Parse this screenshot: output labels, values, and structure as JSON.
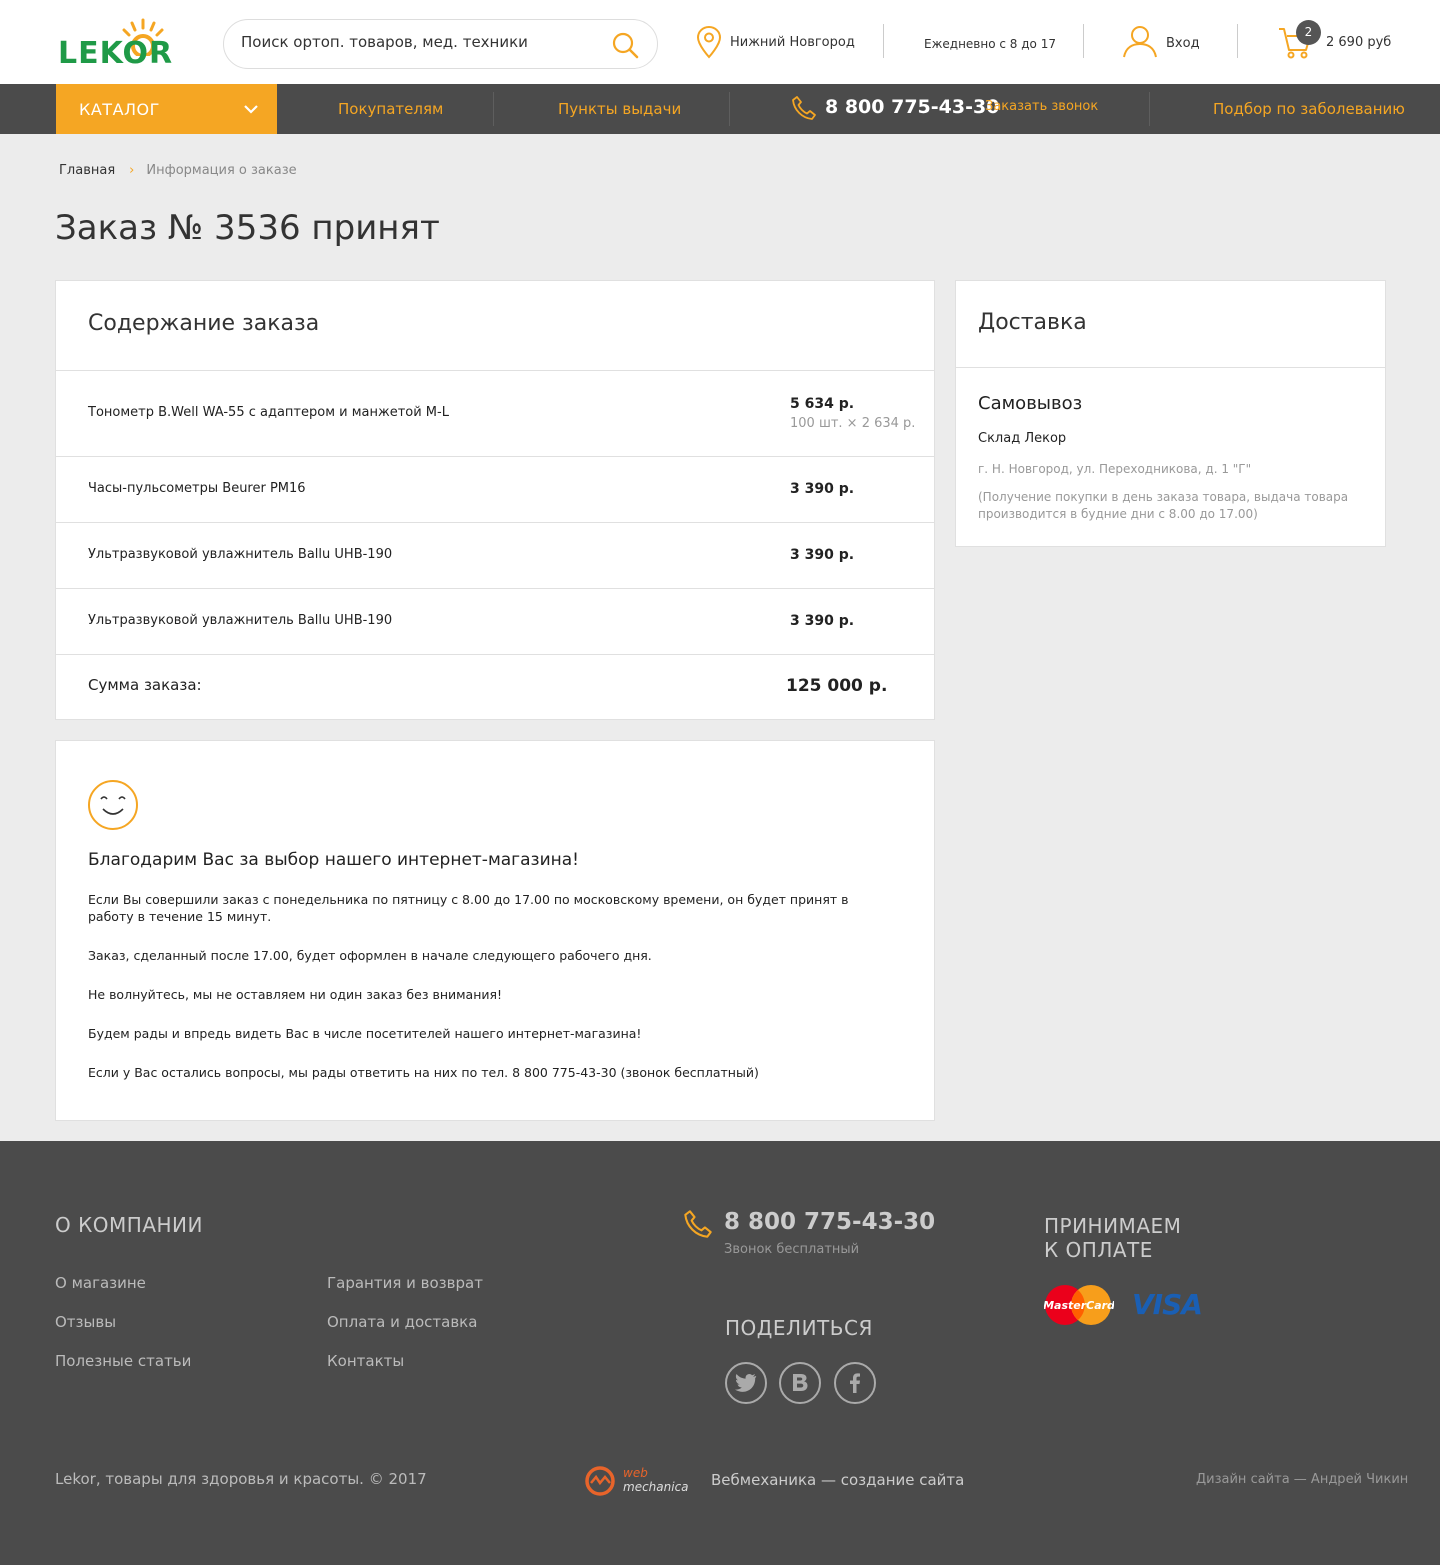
{
  "header": {
    "logo_text": "LEKOR",
    "search_placeholder": "Поиск ортоп. товаров, мед. техники",
    "city": "Нижний Новгород",
    "hours": "Ежедневно с 8 до 17",
    "login": "Вход",
    "cart_count": "2",
    "cart_sum": "2 690 руб"
  },
  "nav": {
    "catalog": "КАТАЛОГ",
    "buyers": "Покупателям",
    "pickup": "Пункты выдачи",
    "phone": "8 800 775-43-30",
    "callback": "Заказать звонок",
    "disease": "Подбор по заболеванию"
  },
  "breadcrumb": {
    "home": "Главная",
    "separator": "›",
    "current": "Информация о заказе"
  },
  "page_title": "Заказ № 3536 принят",
  "order": {
    "title": "Содержание заказа",
    "items": [
      {
        "name": "Тонометр B.Well WA-55 с адаптером и манжетой M-L",
        "price": "5 634 р.",
        "qty": "100 шт. × 2 634 р."
      },
      {
        "name": "Часы-пульсометры Beurer PM16",
        "price": "3 390 р."
      },
      {
        "name": "Ультразвуковой увлажнитель Ballu UHB-190",
        "price": "3 390 р."
      },
      {
        "name": "Ультразвуковой увлажнитель Ballu UHB-190",
        "price": "3 390 р."
      }
    ],
    "total_label": "Сумма заказа:",
    "total_value": "125 000 р."
  },
  "delivery": {
    "title": "Доставка",
    "method": "Самовывоз",
    "point": "Склад Лекор",
    "address": "г. Н. Новгород, ул. Переходникова, д. 1 \"Г\"",
    "note": "(Получение покупки в день заказа товара, выдача товара производится в будние дни с 8.00 до 17.00)"
  },
  "thanks": {
    "title": "Благодарим Вас за выбор нашего интернет-магазина!",
    "paragraphs": [
      "Если Вы совершили заказ с понедельника по пятницу с 8.00 до 17.00 по московскому времени, он будет принят в работу в течение 15 минут.",
      "Заказ, сделанный после 17.00, будет оформлен в начале следующего рабочего дня.",
      "Не волнуйтесь, мы не оставляем ни один заказ без внимания!",
      "Будем рады и впредь видеть Вас в числе посетителей нашего интернет-магазина!",
      "Если у Вас остались вопросы, мы рады ответить на них по тел. 8 800 775-43-30 (звонок бесплатный)"
    ]
  },
  "footer": {
    "company_heading": "О КОМПАНИИ",
    "links": [
      "О  магазине",
      "Гарантия и возврат",
      "Отзывы",
      "Оплата и доставка",
      "Полезные статьи",
      "Контакты"
    ],
    "phone": "8 800 775-43-30",
    "phone_note": "Звонок бесплатный",
    "share_heading": "ПОДЕЛИТЬСЯ",
    "payment_heading_1": "ПРИНИМАЕМ",
    "payment_heading_2": "К ОПЛАТЕ",
    "mastercard_label": "MasterCard",
    "visa_label": "VISA",
    "copyright": "Lekor, товары для здоровья и красоты. © 2017",
    "webmechanica_logo_1": "web",
    "webmechanica_logo_2": "mechanica",
    "webmechanica": "Вебмеханика — создание сайта",
    "design": "Дизайн сайта — Андрей Чикин"
  },
  "colors": {
    "accent": "#f5a623",
    "logo_green": "#1f9a47",
    "nav_bg": "#4b4b4b",
    "page_bg": "#ececec"
  },
  "icons": [
    "sun-logo-icon",
    "search-icon",
    "location-pin-icon",
    "user-icon",
    "cart-icon",
    "chevron-down-icon",
    "phone-icon",
    "smile-icon",
    "twitter-icon",
    "vk-icon",
    "facebook-icon",
    "mastercard-icon",
    "visa-icon",
    "webmechanica-logo-icon"
  ]
}
